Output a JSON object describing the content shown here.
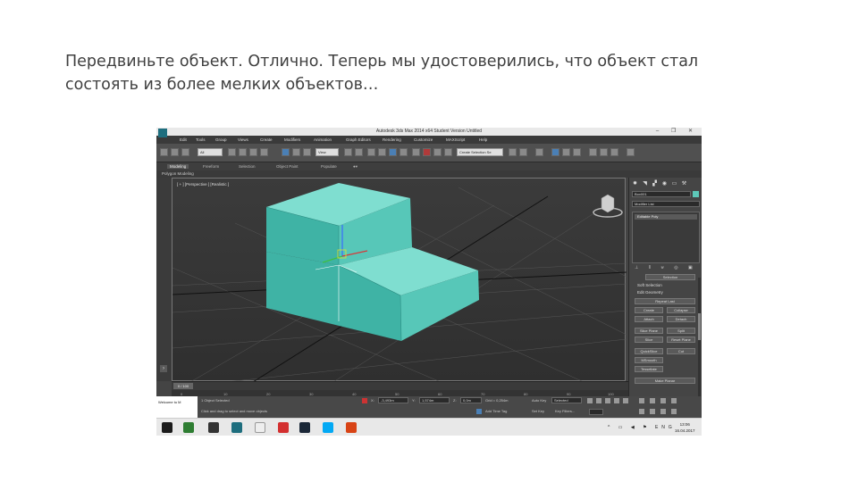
{
  "slide": {
    "line1": "Передвиньте объект. Отлично. Теперь мы удостоверились, что объект стал",
    "line2": "состоять из более мелких объектов…"
  },
  "window": {
    "title": "Autodesk 3ds Max 2014 x64    Student Version    Untitled"
  },
  "menu": [
    "Edit",
    "Tools",
    "Group",
    "Views",
    "Create",
    "Modifiers",
    "Animation",
    "Graph Editors",
    "Rendering",
    "Customize",
    "MAXScript",
    "Help"
  ],
  "toolbar": {
    "selection_filter": "All",
    "ref_coord": "View",
    "named_selection": "Create Selection Se"
  },
  "ribbon": {
    "tabs": [
      "Modeling",
      "Freeform",
      "Selection",
      "Object Paint",
      "Populate"
    ],
    "sub": "Polygon Modeling"
  },
  "viewport": {
    "label": "[ + ] [Perspective ] [Realistic ]"
  },
  "command_panel": {
    "object_name": "Box001",
    "modifier_list": "Modifier List",
    "stack_item": "Editable Poly",
    "rollouts": [
      "Selection",
      "Soft Selection",
      "Edit Geometry"
    ],
    "buttons": [
      "Repeat Last",
      "Create",
      "Collapse",
      "Attach",
      "Detach",
      "Slice Plane",
      "Split",
      "Slice",
      "Reset Plane",
      "QuickSlice",
      "Cut",
      "MSmooth",
      "Tessellate",
      "Make Planar"
    ]
  },
  "timeline": {
    "slider": "0 / 100",
    "ticks": [
      "0",
      "10",
      "20",
      "30",
      "40",
      "50",
      "60",
      "70",
      "80",
      "90",
      "100"
    ]
  },
  "status": {
    "maxscript": "Welcome to M",
    "selected": "1 Object Selected",
    "prompt": "Click and drag to select and move objects",
    "x": "-3,493m",
    "y": "1,574m",
    "z": "0,0m",
    "grid": "Grid = 0,254m",
    "add_time_tag": "Add Time Tag",
    "auto_key": "Auto Key",
    "set_key": "Set Key",
    "selected_dropdown": "Selected",
    "key_filters": "Key Filters..."
  },
  "taskbar": {
    "time": "13:06",
    "date": "16.04.2017",
    "lang": "ENG"
  },
  "colors": {
    "box_top": "#7fded0",
    "box_front": "#3fb3a5",
    "box_side": "#57c7b8"
  }
}
